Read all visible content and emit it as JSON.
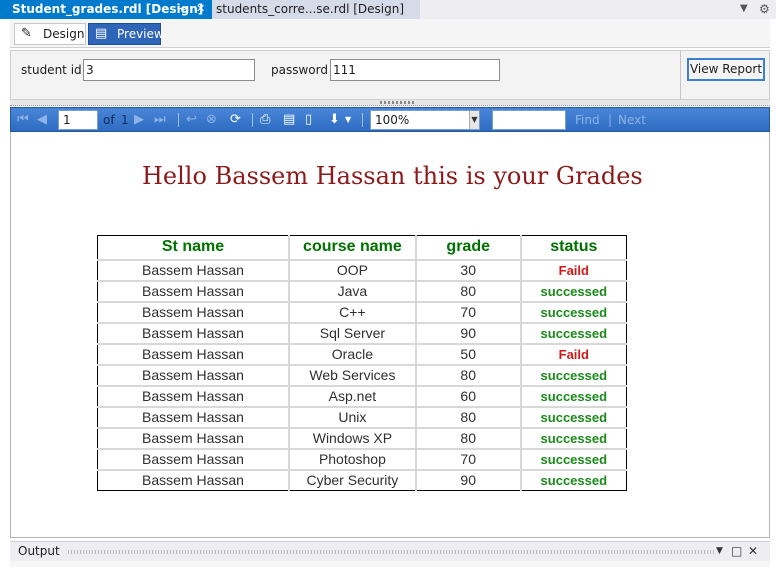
{
  "tabs": [
    {
      "label": "Student_grades.rdl [Design]",
      "active": true
    },
    {
      "label": "students_corre...se.rdl [Design]",
      "active": false
    }
  ],
  "modes": {
    "design": "Design",
    "preview": "Preview"
  },
  "params": {
    "student_id_label": "student id",
    "student_id_value": "3",
    "password_label": "password",
    "password_value": "111",
    "view_report": "View Report"
  },
  "toolbar": {
    "page": "1",
    "of_label": "of",
    "total_pages": "1",
    "zoom": "100%",
    "find_label": "Find",
    "next_label": "Next",
    "separator": "|",
    "find_value": ""
  },
  "report": {
    "greeting": "Hello Bassem Hassan this is your Grades",
    "columns": [
      "St name",
      "course name",
      "grade",
      "status"
    ],
    "rows": [
      {
        "name": "Bassem Hassan",
        "course": "OOP",
        "grade": "30",
        "status": "Faild"
      },
      {
        "name": "Bassem Hassan",
        "course": "Java",
        "grade": "80",
        "status": "successed"
      },
      {
        "name": "Bassem Hassan",
        "course": "C++",
        "grade": "70",
        "status": "successed"
      },
      {
        "name": "Bassem Hassan",
        "course": "Sql Server",
        "grade": "90",
        "status": "successed"
      },
      {
        "name": "Bassem Hassan",
        "course": "Oracle",
        "grade": "50",
        "status": "Faild"
      },
      {
        "name": "Bassem Hassan",
        "course": "Web Services",
        "grade": "80",
        "status": "successed"
      },
      {
        "name": "Bassem Hassan",
        "course": "Asp.net",
        "grade": "60",
        "status": "successed"
      },
      {
        "name": "Bassem Hassan",
        "course": "Unix",
        "grade": "80",
        "status": "successed"
      },
      {
        "name": "Bassem Hassan",
        "course": "Windows XP",
        "grade": "80",
        "status": "successed"
      },
      {
        "name": "Bassem Hassan",
        "course": "Photoshop",
        "grade": "70",
        "status": "successed"
      },
      {
        "name": "Bassem Hassan",
        "course": "Cyber Security",
        "grade": "90",
        "status": "successed"
      }
    ]
  },
  "output": {
    "title": "Output"
  },
  "colors": {
    "active_tab": "#007acc",
    "toolbar": "#2d6cc2",
    "greeting": "#8b1a1a",
    "header_text": "#007200",
    "pass": "#1a8a1a",
    "fail": "#d11a1a"
  }
}
